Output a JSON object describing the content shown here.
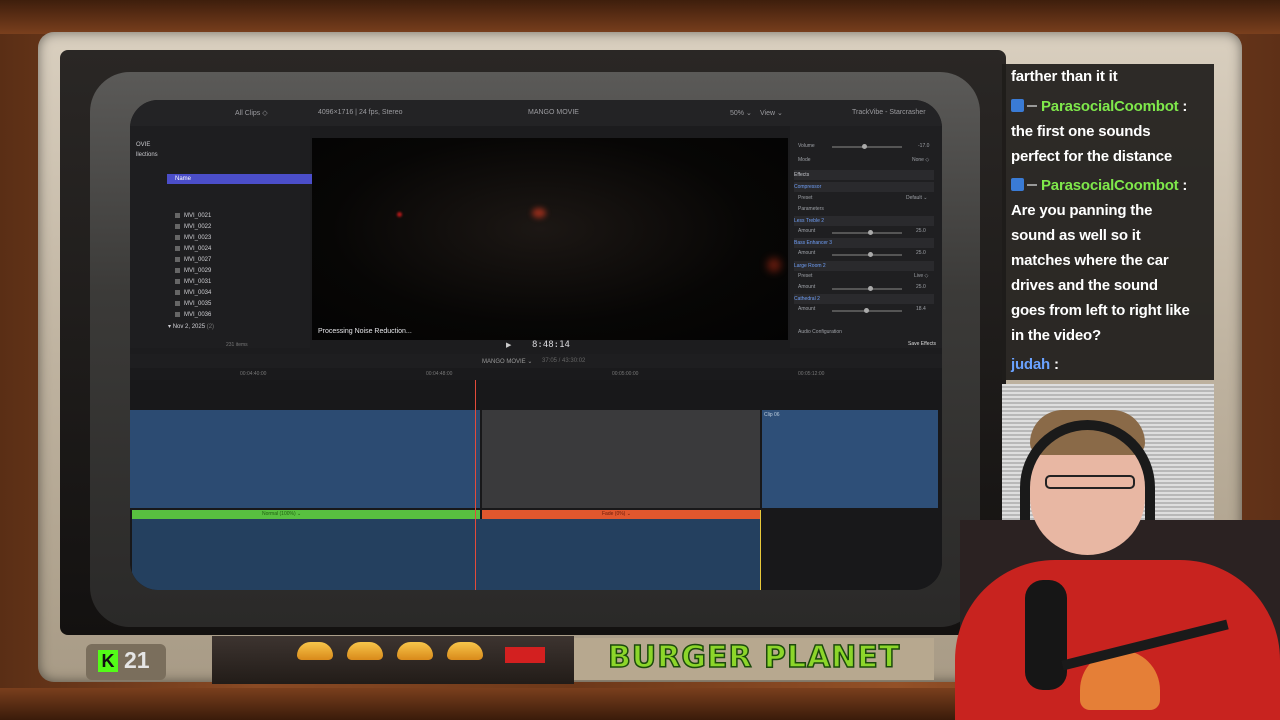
{
  "fcp": {
    "browser_filter": "All Clips ◇",
    "format": "4096×1716 | 24 fps, Stereo",
    "project_title": "MANGO MOVIE",
    "zoom": "50% ⌄",
    "view": "View ⌄",
    "inspector_title": "TrackVibe - Starcrasher",
    "sidebar_items": [
      "OVIE",
      "llections"
    ],
    "name_header": "Name",
    "clips": [
      "MVI_0021",
      "MVI_0022",
      "MVI_0023",
      "MVI_0024",
      "MVI_0027",
      "MVI_0029",
      "MVI_0031",
      "MVI_0034",
      "MVI_0035",
      "MVI_0036"
    ],
    "date_group": "Nov 2, 2025",
    "date_count": "(2)",
    "items_count": "231 items",
    "processing": "Processing Noise Reduction...",
    "timecode": "8:48:14",
    "timeline_title": "MANGO MOVIE ⌄",
    "timeline_duration": "37:05 / 43:30:02",
    "ruler": [
      "00:04:40:00",
      "00:04:48:00",
      "00:05:00:00",
      "00:05:12:00"
    ],
    "inspector": {
      "volume_label": "Volume",
      "volume_value": "-17.0",
      "mode_label": "Mode",
      "mode_value": "None ◇",
      "effects": "Effects",
      "compressor": "Compressor",
      "preset_label": "Preset",
      "preset_value": "Default ⌄",
      "parameters": "Parameters",
      "less_treble": "Less Treble 2",
      "bass_enhancer": "Bass Enhancer 3",
      "large_room": "Large Room 2",
      "cathedral": "Cathedral 2",
      "amount_label": "Amount",
      "amount_values": [
        "25.0",
        "25.0",
        "25.0",
        "18.4"
      ],
      "live_value": "Live ◇",
      "audio_config": "Audio Configuration",
      "save_effects": "Save Effects"
    },
    "audio_green_label": "Normal (100%) ⌄",
    "audio_red_label": "Fade (0%) ⌄",
    "clip_label": "Clip 06"
  },
  "chat": {
    "lines": [
      {
        "user": "",
        "text": "farther than it it"
      },
      {
        "user": "ParasocialCoombot",
        "text": ""
      },
      {
        "user": "",
        "text": "the first one sounds"
      },
      {
        "user": "",
        "text": "perfect for the distance"
      },
      {
        "user": "ParasocialCoombot",
        "text": ""
      },
      {
        "user": "",
        "text": "Are you panning the"
      },
      {
        "user": "",
        "text": "sound as well so it"
      },
      {
        "user": "",
        "text": "matches where the car"
      },
      {
        "user": "",
        "text": "drives and the sound"
      },
      {
        "user": "",
        "text": "goes from left to right like"
      },
      {
        "user": "",
        "text": "in the video?"
      },
      {
        "user": "judah",
        "text": ""
      }
    ]
  },
  "overlay": {
    "viewer_count": "21",
    "kick_logo": "K",
    "sign": "BURGER PLANET",
    "colors": {
      "kick": "#53fc18",
      "sign_text": "#8cd62a",
      "chat_user": "#7fe84b",
      "chat_user_alt": "#6aa2ff"
    }
  }
}
